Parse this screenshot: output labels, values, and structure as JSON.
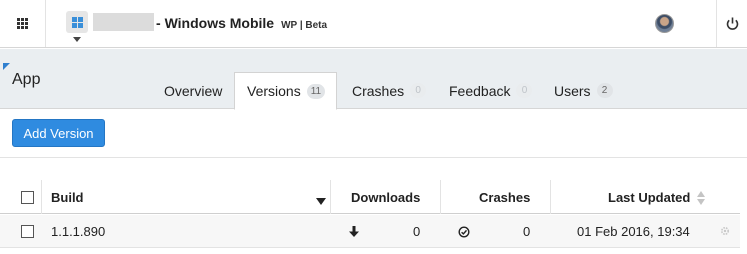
{
  "topbar": {
    "app_name": "Windows Mobile",
    "app_name_prefix": "- ",
    "platform": "WP | Beta"
  },
  "header": {
    "title": "App",
    "tabs": [
      {
        "label": "Overview",
        "count": null
      },
      {
        "label": "Versions",
        "count": "11",
        "active": true
      },
      {
        "label": "Crashes",
        "count": "0"
      },
      {
        "label": "Feedback",
        "count": "0"
      },
      {
        "label": "Users",
        "count": "2"
      }
    ]
  },
  "toolbar": {
    "add_version_label": "Add Version"
  },
  "table": {
    "columns": [
      "Build",
      "Downloads",
      "Crashes",
      "Last Updated"
    ],
    "rows": [
      {
        "build": "1.1.1.890",
        "downloads": "0",
        "crashes": "0",
        "last_updated": "01 Feb 2016, 19:34"
      }
    ]
  },
  "colors": {
    "accent": "#2f8be0",
    "band": "#eaeef1"
  },
  "icons": [
    "app-grid-icon",
    "windows-logo-icon",
    "caret-down-icon",
    "avatar",
    "power-icon",
    "download-icon",
    "crash-check-icon",
    "sort-arrows-icon",
    "gear-icon"
  ]
}
